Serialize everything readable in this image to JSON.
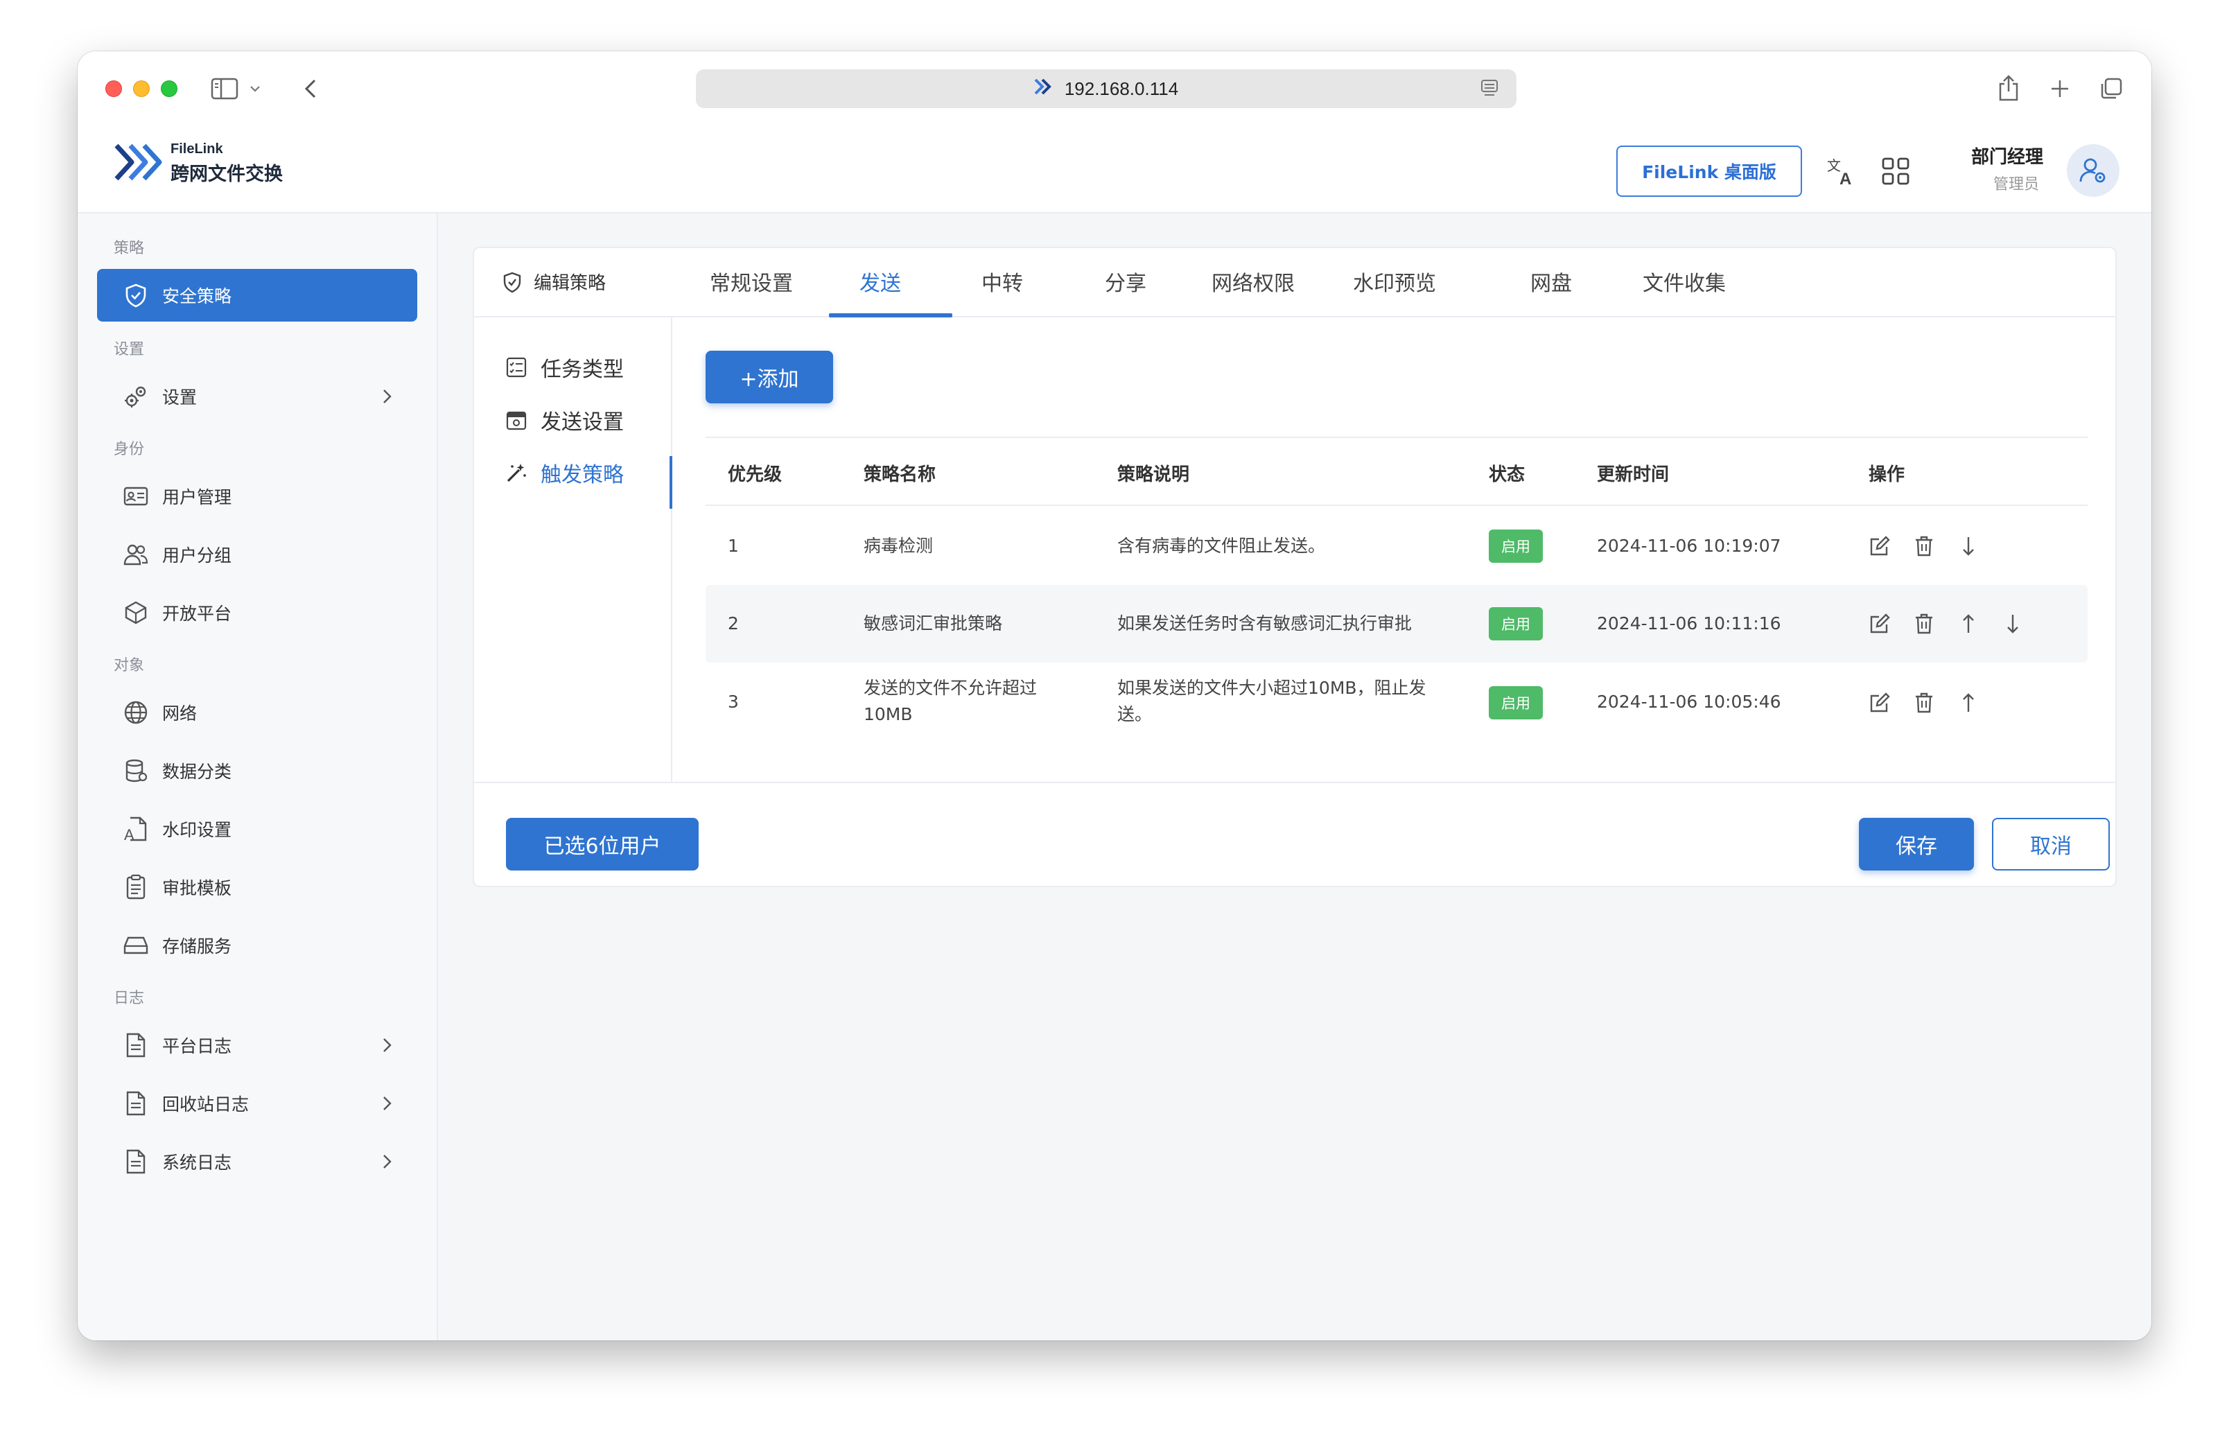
{
  "browser": {
    "url": "192.168.0.114"
  },
  "app": {
    "logo_small": "FileLink",
    "logo_title": "跨网文件交换",
    "desktop_button": "FileLink 桌面版",
    "user_name": "部门经理",
    "user_role": "管理员"
  },
  "sidebar": {
    "groups": {
      "policy": "策略",
      "settings": "设置",
      "identity": "身份",
      "objects": "对象",
      "logs": "日志"
    },
    "items": {
      "security_policy": "安全策略",
      "settings": "设置",
      "user_mgmt": "用户管理",
      "user_group": "用户分组",
      "open_platform": "开放平台",
      "network": "网络",
      "data_class": "数据分类",
      "watermark": "水印设置",
      "approval_tpl": "审批模板",
      "storage": "存储服务",
      "platform_log": "平台日志",
      "recycle_log": "回收站日志",
      "system_log": "系统日志"
    }
  },
  "tabs": {
    "edit_policy": "编辑策略",
    "general": "常规设置",
    "send": "发送",
    "relay": "中转",
    "share": "分享",
    "net_perm": "网络权限",
    "watermark_preview": "水印预览",
    "netdisk": "网盘",
    "file_collect": "文件收集"
  },
  "subnav": {
    "task_type": "任务类型",
    "send_settings": "发送设置",
    "trigger_policy": "触发策略"
  },
  "toolbar": {
    "add_label": "+添加"
  },
  "table": {
    "headers": {
      "priority": "优先级",
      "name": "策略名称",
      "desc": "策略说明",
      "status": "状态",
      "updated": "更新时间",
      "ops": "操作"
    },
    "rows": [
      {
        "priority": "1",
        "name": "病毒检测",
        "desc": "含有病毒的文件阻止发送。",
        "status": "启用",
        "updated": "2024-11-06 10:19:07"
      },
      {
        "priority": "2",
        "name": "敏感词汇审批策略",
        "desc": "如果发送任务时含有敏感词汇执行审批",
        "status": "启用",
        "updated": "2024-11-06 10:11:16"
      },
      {
        "priority": "3",
        "name": "发送的文件不允许超过10MB",
        "desc": "如果发送的文件大小超过10MB，阻止发送。",
        "status": "启用",
        "updated": "2024-11-06 10:05:46"
      }
    ]
  },
  "footer": {
    "selected_users": "已选6位用户",
    "save": "保存",
    "cancel": "取消"
  },
  "colors": {
    "accent": "#2f74d0",
    "status_enabled": "#4fba68"
  }
}
